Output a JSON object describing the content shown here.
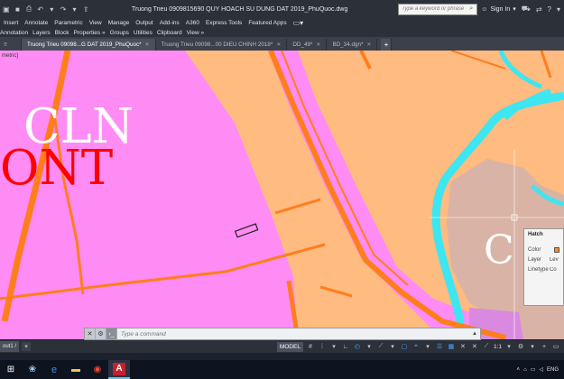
{
  "window": {
    "title": "Truong Trieu 0909815690 QUY HOACH SU DUNG DAT 2019_PhuQuoc.dwg",
    "search_placeholder": "Type a keyword or phrase",
    "sign_in": "Sign In"
  },
  "menu": [
    "Insert",
    "Annotate",
    "Parametric",
    "View",
    "Manage",
    "Output",
    "Add-ins",
    "A360",
    "Express Tools",
    "Featured Apps"
  ],
  "ribbon": [
    "Annotation",
    "Layers",
    "Block",
    "Properties »",
    "Groups",
    "Utilities",
    "Clipboard",
    "View »"
  ],
  "tabs": [
    {
      "label": "Truong Trieu 09098...G DAT 2019_PhuQuoc*",
      "active": true
    },
    {
      "label": "Truong Trieu 09098...00 DIEU CHINH 2018*",
      "active": false
    },
    {
      "label": "DD_49*",
      "active": false
    },
    {
      "label": "BD_34.dgn*",
      "active": false
    }
  ],
  "canvas": {
    "view_label": "metric]",
    "zone_labels": [
      {
        "text": "CLN",
        "color": "#ffffff"
      },
      {
        "text": "ONT",
        "color": "#ff0000"
      },
      {
        "text": "C",
        "color": "#ffffff"
      }
    ]
  },
  "hatch_panel": {
    "heading": "Hatch",
    "rows": [
      {
        "key": "Color",
        "value": ""
      },
      {
        "key": "Layer",
        "value": "Lev"
      },
      {
        "key": "Linetype",
        "value": "Co"
      }
    ],
    "swatch_color": "#ff8c2a"
  },
  "command": {
    "placeholder": "Type a command"
  },
  "status": {
    "layout_tab": "out1 /",
    "model": "MODEL",
    "scale": "1:1"
  },
  "taskbar": {
    "language": "ENG"
  },
  "colors": {
    "pink_zone": "#ff8cf4",
    "orange_zone": "#ffbb80",
    "road": "#ff7e1c",
    "water": "#3de6f0",
    "tan_zone": "#d9b3a6",
    "violet_zone": "#d98ae0"
  }
}
